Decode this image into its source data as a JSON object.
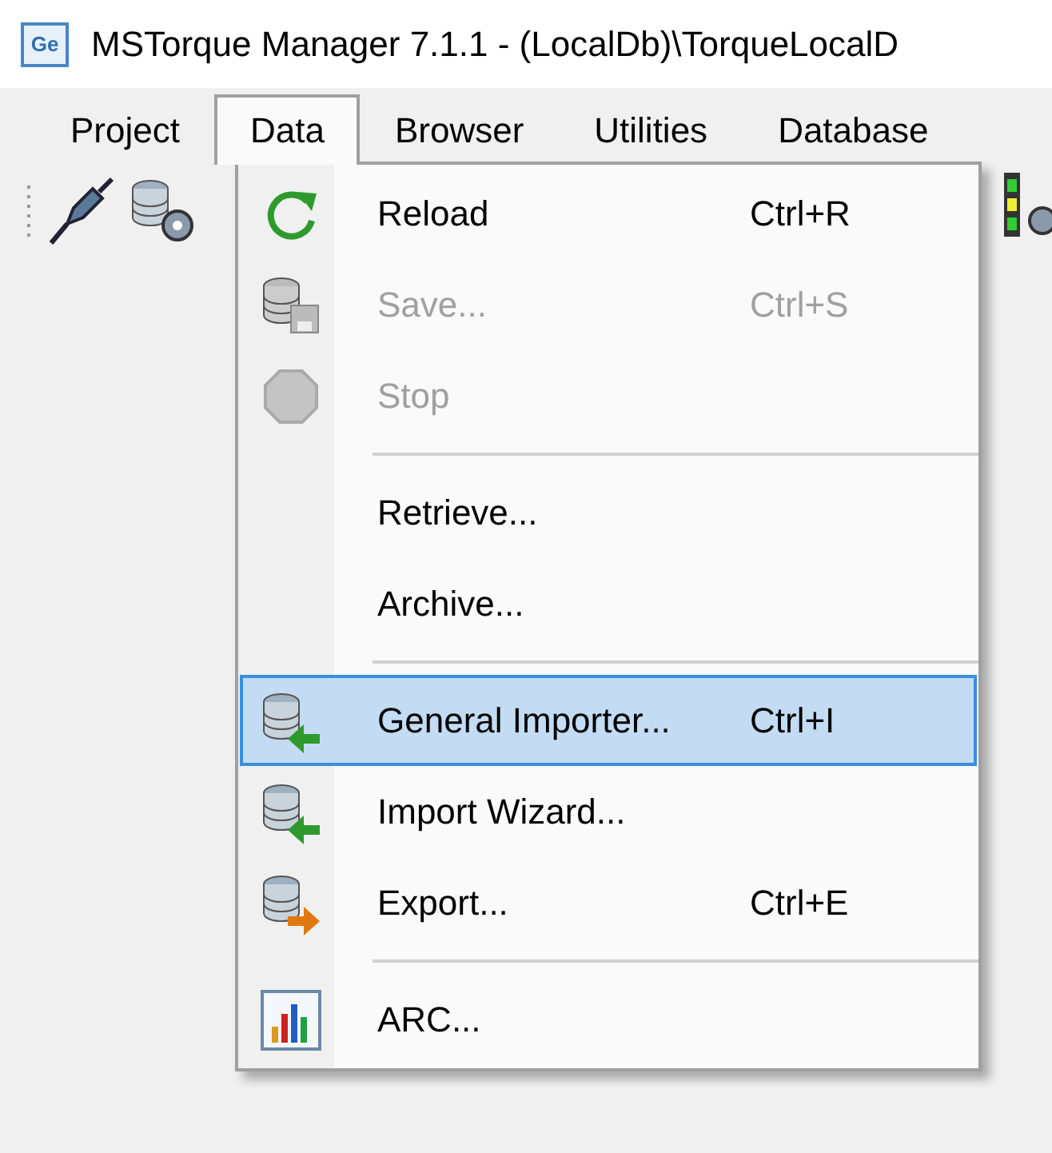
{
  "window": {
    "app_icon": "Ge",
    "title": "MSTorque Manager 7.1.1 - (LocalDb)\\TorqueLocalD"
  },
  "menu_bar": [
    {
      "label": "Project",
      "selected": false
    },
    {
      "label": "Data",
      "selected": true
    },
    {
      "label": "Browser",
      "selected": false
    },
    {
      "label": "Utilities",
      "selected": false
    },
    {
      "label": "Database",
      "selected": false
    }
  ],
  "menu": {
    "items": [
      {
        "kind": "item",
        "label": "Reload",
        "shortcut": "Ctrl+R",
        "disabled": false,
        "selected": false
      },
      {
        "kind": "item",
        "label": "Save...",
        "shortcut": "Ctrl+S",
        "disabled": true,
        "selected": false
      },
      {
        "kind": "item",
        "label": "Stop",
        "disabled": true,
        "selected": false
      },
      {
        "kind": "separator"
      },
      {
        "kind": "item",
        "label": "Retrieve...",
        "disabled": false,
        "selected": false
      },
      {
        "kind": "item",
        "label": "Archive...",
        "disabled": false,
        "selected": false
      },
      {
        "kind": "separator"
      },
      {
        "kind": "item",
        "label": "General Importer...",
        "shortcut": "Ctrl+I",
        "disabled": false,
        "selected": true
      },
      {
        "kind": "item",
        "label": "Import Wizard...",
        "disabled": false,
        "selected": false
      },
      {
        "kind": "item",
        "label": "Export...",
        "shortcut": "Ctrl+E",
        "disabled": false,
        "selected": false
      },
      {
        "kind": "separator"
      },
      {
        "kind": "item",
        "label": "ARC...",
        "disabled": false,
        "selected": false
      }
    ]
  }
}
